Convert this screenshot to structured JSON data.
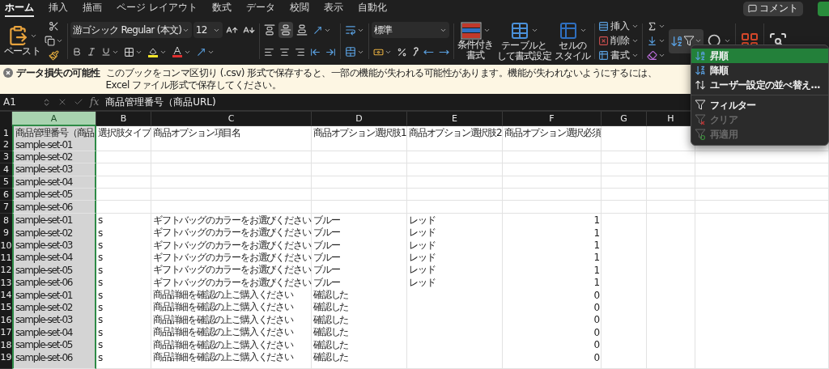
{
  "tabs": [
    {
      "label": "ホーム",
      "selected": true
    },
    {
      "label": "挿入",
      "selected": false
    },
    {
      "label": "描画",
      "selected": false
    },
    {
      "label": "ページ レイアウト",
      "selected": false
    },
    {
      "label": "数式",
      "selected": false
    },
    {
      "label": "データ",
      "selected": false
    },
    {
      "label": "校閲",
      "selected": false
    },
    {
      "label": "表示",
      "selected": false
    },
    {
      "label": "自動化",
      "selected": false
    }
  ],
  "comment_button": "コメント",
  "ribbon": {
    "paste_label": "ペースト",
    "font_name": "游ゴシック Regular (本文)",
    "font_size": "12",
    "vertical_align": [
      {
        "kind": "top",
        "selected": false
      },
      {
        "kind": "middle",
        "selected": true
      },
      {
        "kind": "bottom",
        "selected": false
      }
    ],
    "number_format": "標準",
    "styles": [
      {
        "kind": "conditional",
        "lines": [
          "条件付き",
          "書式"
        ]
      },
      {
        "kind": "table",
        "lines": [
          "テーブルと",
          "して書式設定"
        ]
      },
      {
        "kind": "cell",
        "lines": [
          "セルの",
          "スタイル"
        ]
      }
    ],
    "cells": [
      {
        "kind": "insert",
        "label": "挿入"
      },
      {
        "kind": "delete",
        "label": "削除"
      },
      {
        "kind": "format",
        "label": "書式"
      }
    ],
    "sort_filter_open": true
  },
  "message_bar": {
    "title": "データ損失の可能性",
    "text": "このブックをコンマ区切り (.csv) 形式で保存すると、一部の機能が失われる可能性があります。機能が失われないようにするには、Excel ファイル形式で保存してください。"
  },
  "formula_bar": {
    "name_box": "A1",
    "function_label": "fx",
    "formula": "商品管理番号（商品URL)"
  },
  "columns": [
    {
      "label": "A",
      "selected": true
    },
    {
      "label": "B",
      "selected": false
    },
    {
      "label": "C",
      "selected": false
    },
    {
      "label": "D",
      "selected": false
    },
    {
      "label": "E",
      "selected": false
    },
    {
      "label": "F",
      "selected": false
    },
    {
      "label": "G",
      "selected": false
    },
    {
      "label": "H",
      "selected": false
    }
  ],
  "rows": [
    {
      "number": "1",
      "cells": {
        "A": {
          "text": "商品管理番号（商品",
          "kind": "text"
        },
        "B": {
          "text": "選択肢タイプ",
          "kind": "text"
        },
        "C": {
          "text": "商品オプション項目名",
          "kind": "text"
        },
        "D": {
          "text": "商品オプション選択肢1",
          "kind": "text"
        },
        "E": {
          "text": "商品オプション選択肢2",
          "kind": "text"
        },
        "F": {
          "text": "商品オプション選択必須",
          "kind": "text"
        }
      }
    },
    {
      "number": "2",
      "cells": {
        "A": {
          "text": "sample-set-01",
          "kind": "text"
        }
      }
    },
    {
      "number": "3",
      "cells": {
        "A": {
          "text": "sample-set-02",
          "kind": "text"
        }
      }
    },
    {
      "number": "4",
      "cells": {
        "A": {
          "text": "sample-set-03",
          "kind": "text"
        }
      }
    },
    {
      "number": "5",
      "cells": {
        "A": {
          "text": "sample-set-04",
          "kind": "text"
        }
      }
    },
    {
      "number": "6",
      "cells": {
        "A": {
          "text": "sample-set-05",
          "kind": "text"
        }
      }
    },
    {
      "number": "7",
      "cells": {
        "A": {
          "text": "sample-set-06",
          "kind": "text"
        }
      }
    },
    {
      "number": "8",
      "cells": {
        "A": {
          "text": "sample-set-01",
          "kind": "text"
        },
        "B": {
          "text": "s",
          "kind": "text"
        },
        "C": {
          "text": "ギフトバッグのカラーをお選びください",
          "kind": "text"
        },
        "D": {
          "text": "ブルー",
          "kind": "text"
        },
        "E": {
          "text": "レッド",
          "kind": "text"
        },
        "F": {
          "text": "1",
          "kind": "number"
        }
      }
    },
    {
      "number": "9",
      "cells": {
        "A": {
          "text": "sample-set-02",
          "kind": "text"
        },
        "B": {
          "text": "s",
          "kind": "text"
        },
        "C": {
          "text": "ギフトバッグのカラーをお選びください",
          "kind": "text"
        },
        "D": {
          "text": "ブルー",
          "kind": "text"
        },
        "E": {
          "text": "レッド",
          "kind": "text"
        },
        "F": {
          "text": "1",
          "kind": "number"
        }
      }
    },
    {
      "number": "10",
      "cells": {
        "A": {
          "text": "sample-set-03",
          "kind": "text"
        },
        "B": {
          "text": "s",
          "kind": "text"
        },
        "C": {
          "text": "ギフトバッグのカラーをお選びください",
          "kind": "text"
        },
        "D": {
          "text": "ブルー",
          "kind": "text"
        },
        "E": {
          "text": "レッド",
          "kind": "text"
        },
        "F": {
          "text": "1",
          "kind": "number"
        }
      }
    },
    {
      "number": "11",
      "cells": {
        "A": {
          "text": "sample-set-04",
          "kind": "text"
        },
        "B": {
          "text": "s",
          "kind": "text"
        },
        "C": {
          "text": "ギフトバッグのカラーをお選びください",
          "kind": "text"
        },
        "D": {
          "text": "ブルー",
          "kind": "text"
        },
        "E": {
          "text": "レッド",
          "kind": "text"
        },
        "F": {
          "text": "1",
          "kind": "number"
        }
      }
    },
    {
      "number": "12",
      "cells": {
        "A": {
          "text": "sample-set-05",
          "kind": "text"
        },
        "B": {
          "text": "s",
          "kind": "text"
        },
        "C": {
          "text": "ギフトバッグのカラーをお選びください",
          "kind": "text"
        },
        "D": {
          "text": "ブルー",
          "kind": "text"
        },
        "E": {
          "text": "レッド",
          "kind": "text"
        },
        "F": {
          "text": "1",
          "kind": "number"
        }
      }
    },
    {
      "number": "13",
      "cells": {
        "A": {
          "text": "sample-set-06",
          "kind": "text"
        },
        "B": {
          "text": "s",
          "kind": "text"
        },
        "C": {
          "text": "ギフトバッグのカラーをお選びください",
          "kind": "text"
        },
        "D": {
          "text": "ブルー",
          "kind": "text"
        },
        "E": {
          "text": "レッド",
          "kind": "text"
        },
        "F": {
          "text": "1",
          "kind": "number"
        }
      }
    },
    {
      "number": "14",
      "cells": {
        "A": {
          "text": "sample-set-01",
          "kind": "text"
        },
        "B": {
          "text": "s",
          "kind": "text"
        },
        "C": {
          "text": "商品詳細を確認の上ご購入ください",
          "kind": "text"
        },
        "D": {
          "text": "確認した",
          "kind": "text"
        },
        "F": {
          "text": "0",
          "kind": "number"
        }
      }
    },
    {
      "number": "15",
      "cells": {
        "A": {
          "text": "sample-set-02",
          "kind": "text"
        },
        "B": {
          "text": "s",
          "kind": "text"
        },
        "C": {
          "text": "商品詳細を確認の上ご購入ください",
          "kind": "text"
        },
        "D": {
          "text": "確認した",
          "kind": "text"
        },
        "F": {
          "text": "0",
          "kind": "number"
        }
      }
    },
    {
      "number": "16",
      "cells": {
        "A": {
          "text": "sample-set-03",
          "kind": "text"
        },
        "B": {
          "text": "s",
          "kind": "text"
        },
        "C": {
          "text": "商品詳細を確認の上ご購入ください",
          "kind": "text"
        },
        "D": {
          "text": "確認した",
          "kind": "text"
        },
        "F": {
          "text": "0",
          "kind": "number"
        }
      }
    },
    {
      "number": "17",
      "cells": {
        "A": {
          "text": "sample-set-04",
          "kind": "text"
        },
        "B": {
          "text": "s",
          "kind": "text"
        },
        "C": {
          "text": "商品詳細を確認の上ご購入ください",
          "kind": "text"
        },
        "D": {
          "text": "確認した",
          "kind": "text"
        },
        "F": {
          "text": "0",
          "kind": "number"
        }
      }
    },
    {
      "number": "18",
      "cells": {
        "A": {
          "text": "sample-set-05",
          "kind": "text"
        },
        "B": {
          "text": "s",
          "kind": "text"
        },
        "C": {
          "text": "商品詳細を確認の上ご購入ください",
          "kind": "text"
        },
        "D": {
          "text": "確認した",
          "kind": "text"
        },
        "F": {
          "text": "0",
          "kind": "number"
        }
      }
    },
    {
      "number": "19",
      "cells": {
        "A": {
          "text": "sample-set-06",
          "kind": "text"
        },
        "B": {
          "text": "s",
          "kind": "text"
        },
        "C": {
          "text": "商品詳細を確認の上ご購入ください",
          "kind": "text"
        },
        "D": {
          "text": "確認した",
          "kind": "text"
        },
        "F": {
          "text": "0",
          "kind": "number"
        }
      }
    }
  ],
  "sort_menu": {
    "groups": [
      {
        "items": [
          {
            "kind": "ascending",
            "label": "昇順",
            "selected": true,
            "disabled": false
          },
          {
            "kind": "descending",
            "label": "降順",
            "selected": false,
            "disabled": false
          },
          {
            "kind": "custom",
            "label": "ユーザー設定の並べ替え...",
            "selected": false,
            "disabled": false
          }
        ]
      },
      {
        "items": [
          {
            "kind": "filter",
            "label": "フィルター",
            "selected": false,
            "disabled": false
          },
          {
            "kind": "clear",
            "label": "クリア",
            "selected": false,
            "disabled": true
          },
          {
            "kind": "reapply",
            "label": "再適用",
            "selected": false,
            "disabled": true
          }
        ]
      }
    ]
  }
}
